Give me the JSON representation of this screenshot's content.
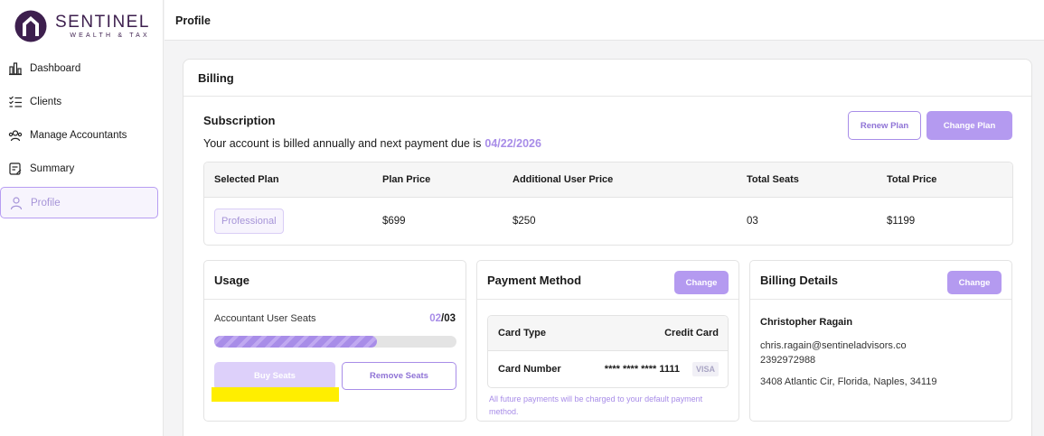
{
  "brand": {
    "name": "SENTINEL",
    "tagline": "WEALTH & TAX",
    "accent": "#3d1f4e"
  },
  "sidebar": {
    "items": [
      {
        "label": "Dashboard",
        "icon": "bar-chart-icon"
      },
      {
        "label": "Clients",
        "icon": "checklist-icon"
      },
      {
        "label": "Manage Accountants",
        "icon": "users-icon"
      },
      {
        "label": "Summary",
        "icon": "summary-icon"
      },
      {
        "label": "Profile",
        "icon": "user-icon",
        "active": true
      }
    ]
  },
  "header": {
    "title": "Profile"
  },
  "billing": {
    "title": "Billing",
    "subscription": {
      "title": "Subscription",
      "billing_text": "Your account is billed annually and next payment due is",
      "due_date": "04/22/2026",
      "renew_label": "Renew Plan",
      "change_label": "Change Plan"
    },
    "plan_table": {
      "headers": [
        "Selected Plan",
        "Plan Price",
        "Additional User Price",
        "Total Seats",
        "Total Price"
      ],
      "row": {
        "plan": "Professional",
        "plan_price": "$699",
        "additional_user_price": "$250",
        "total_seats": "03",
        "total_price": "$1199"
      }
    },
    "usage": {
      "title": "Usage",
      "seats_label": "Accountant User Seats",
      "seats_used": "02",
      "seats_separator": "/",
      "seats_total": "03",
      "progress_fraction": 0.67,
      "buy_label": "Buy Seats",
      "remove_label": "Remove Seats"
    },
    "payment": {
      "title": "Payment Method",
      "change_label": "Change",
      "card_type_label": "Card Type",
      "card_type_value": "Credit Card",
      "card_number_label": "Card Number",
      "card_number_value": "**** **** **** 1111",
      "card_brand": "VISA",
      "note": "All future payments will be charged to your default payment method."
    },
    "details": {
      "title": "Billing Details",
      "change_label": "Change",
      "name": "Christopher Ragain",
      "email": "chris.ragain@sentineladvisors.co",
      "phone": "2392972988",
      "address": "3408 Atlantic Cir, Florida, Naples, 34119"
    }
  },
  "colors": {
    "primary": "#b49af0",
    "primary_text": "#8f73d6",
    "highlight": "#ffee00"
  }
}
